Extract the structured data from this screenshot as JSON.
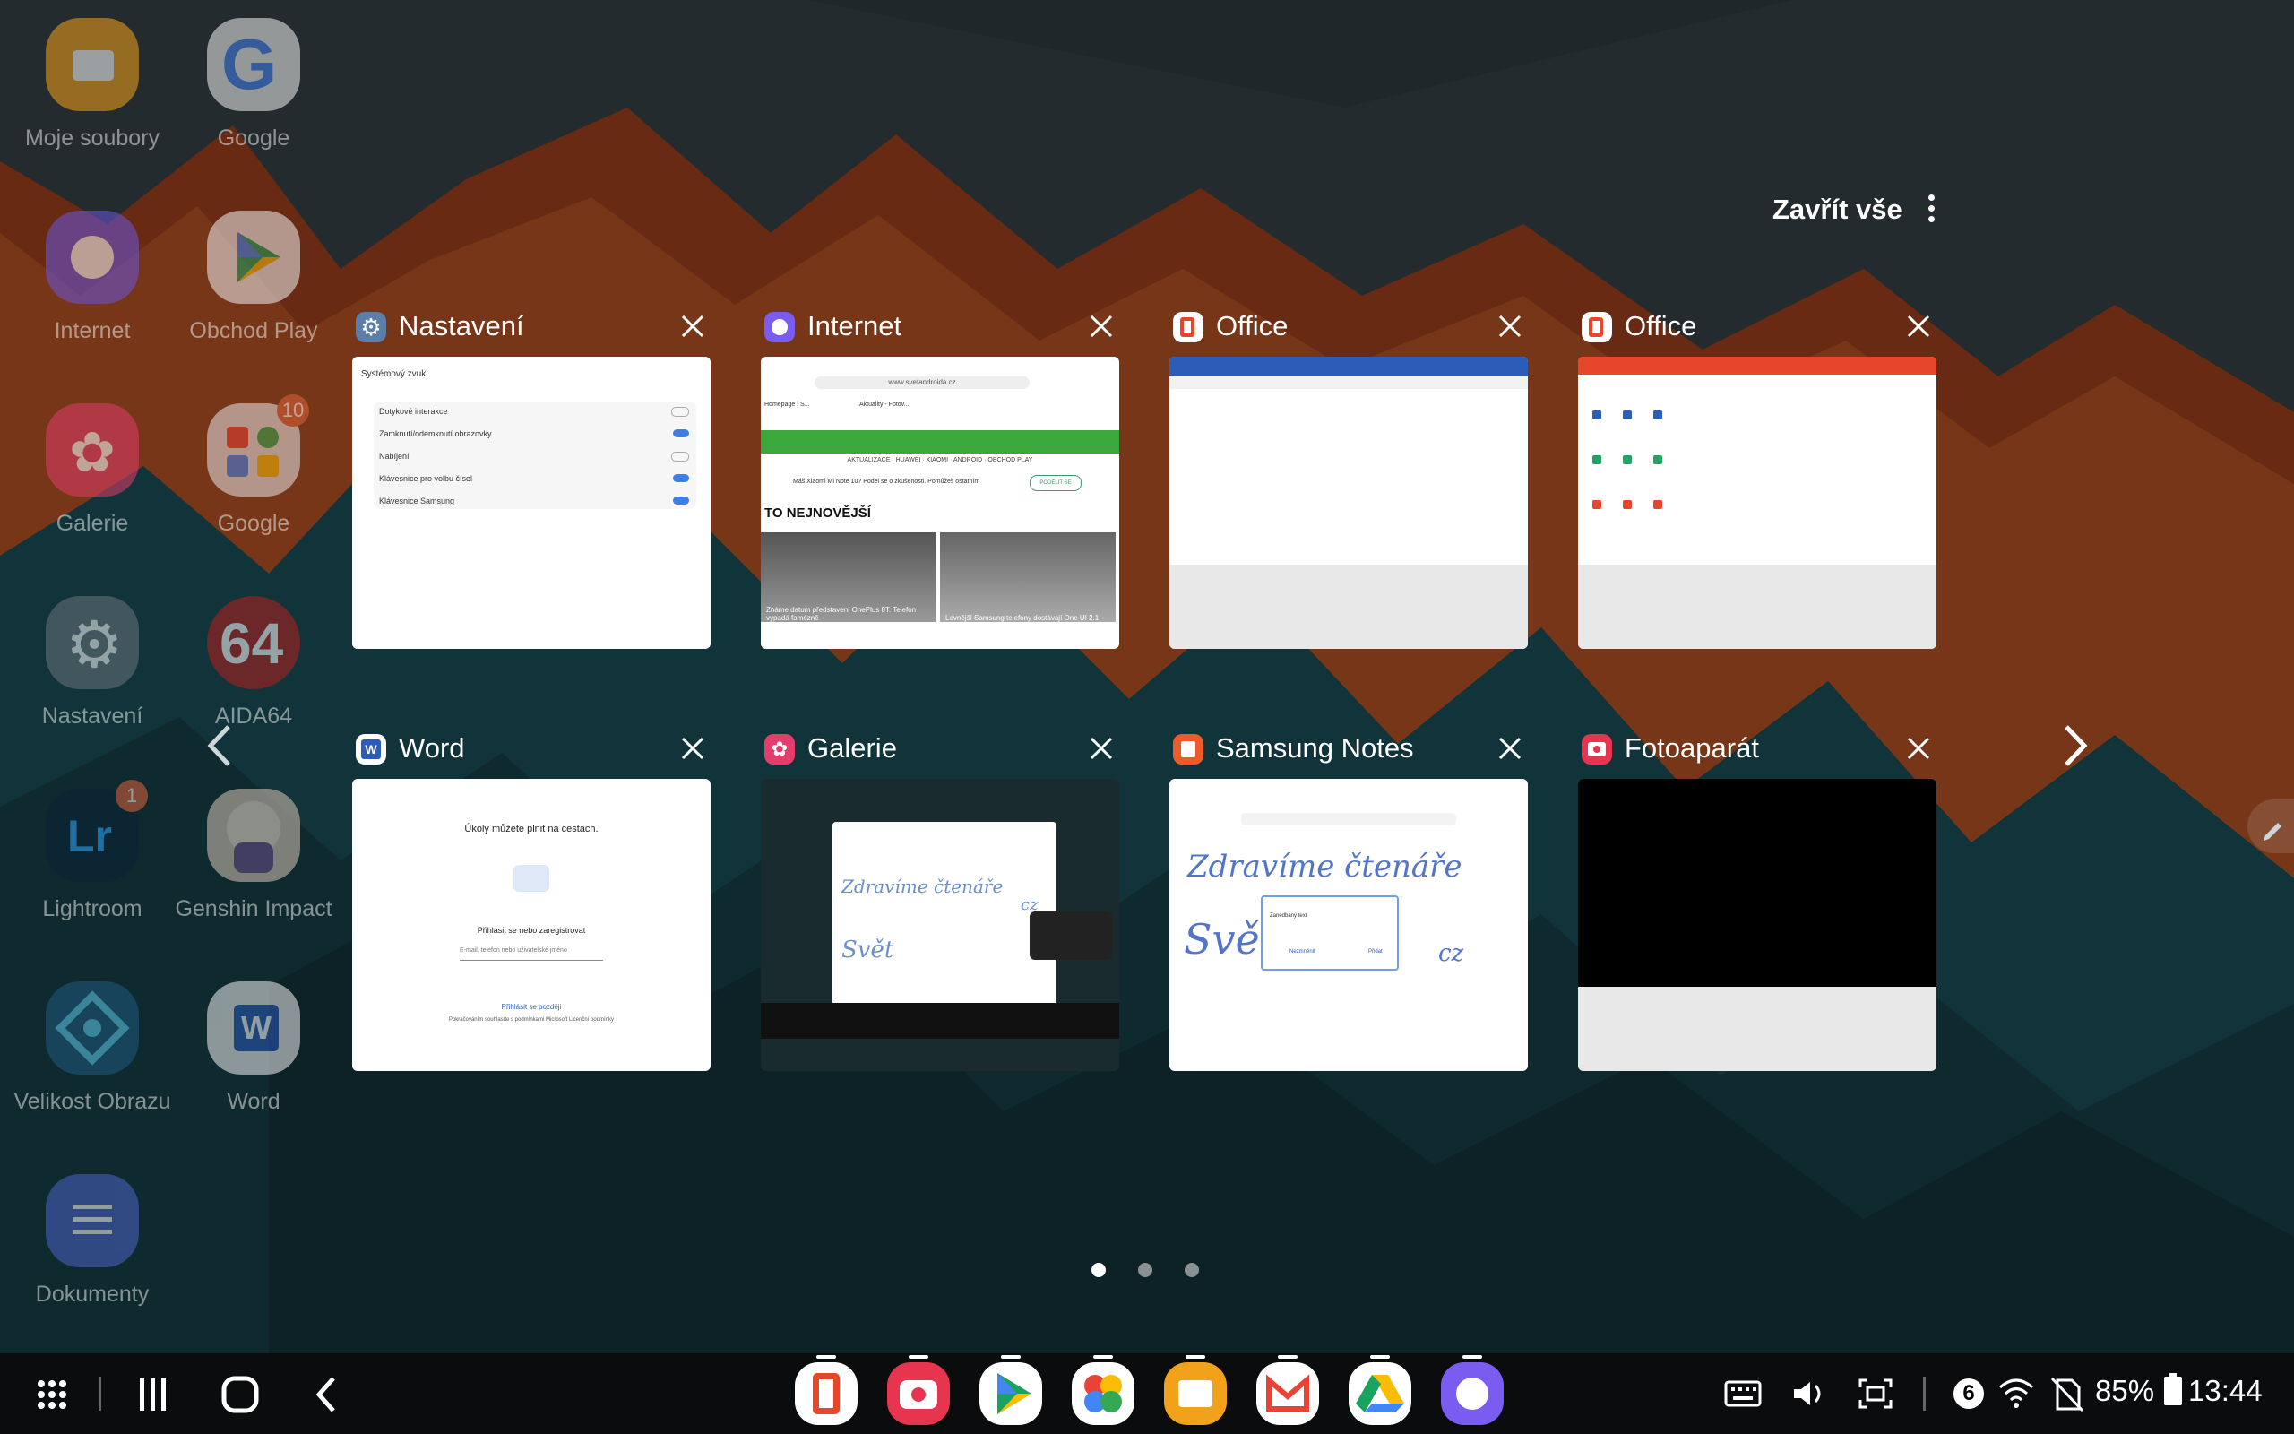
{
  "header": {
    "close_all": "Zavřít vše"
  },
  "home_apps": [
    {
      "label": "Moje soubory"
    },
    {
      "label": "Google"
    },
    {
      "label": "Internet"
    },
    {
      "label": "Obchod Play"
    },
    {
      "label": "Galerie"
    },
    {
      "label": "Google",
      "badge": "10"
    },
    {
      "label": "Nastavení"
    },
    {
      "label": "AIDA64"
    },
    {
      "label": "Lightroom",
      "badge": "1"
    },
    {
      "label": "Genshin Impact"
    },
    {
      "label": "Velikost Obrazu"
    },
    {
      "label": "Word"
    },
    {
      "label": "Dokumenty"
    }
  ],
  "recents": [
    {
      "app": "Nastavení",
      "icon": "settings-icon",
      "color": "#5b7fa8"
    },
    {
      "app": "Internet",
      "icon": "samsung-internet-icon",
      "color": "#7b5cf0"
    },
    {
      "app": "Office",
      "icon": "office-icon",
      "color": "#e6462a"
    },
    {
      "app": "Office",
      "icon": "office-icon",
      "color": "#e6462a"
    },
    {
      "app": "Word",
      "icon": "word-icon",
      "color": "#2b5cb8"
    },
    {
      "app": "Galerie",
      "icon": "gallery-icon",
      "color": "#e23d6b"
    },
    {
      "app": "Samsung Notes",
      "icon": "samsung-notes-icon",
      "color": "#ee5a2a"
    },
    {
      "app": "Fotoaparát",
      "icon": "camera-icon",
      "color": "#e7344f"
    }
  ],
  "thumbs": {
    "settings": {
      "header": "Systémový zvuk",
      "rows": [
        "Dotykové interakce",
        "Zamknutí/odemknutí obrazovky",
        "Nabíjení",
        "Klávesnice pro volbu čísel",
        "Klávesnice Samsung"
      ]
    },
    "internet": {
      "url": "www.svetandroida.cz",
      "tab1": "Homepage | S...",
      "tab2": "Aktuality - Fotov...",
      "menu": "AKTUALIZACE · HUAWEI · XIAOMI · ANDROID · OBCHOD PLAY",
      "promo": "Máš Xiaomi Mi Note 10? Podel se o zkušenosti. Pomůžeš ostatním",
      "promo_btn": "PODĚLIT SE",
      "section": "TO NEJNOVĚJŠÍ",
      "article1": "Známe datum představení OnePlus 8T. Telefon vypadá famózně",
      "article2": "Levnější Samsung telefony dostávají One UI 2.1"
    },
    "word": {
      "line1": "Úkoly můžete plnit na cestách.",
      "line2": "Přihlásit se nebo zaregistrovat",
      "input_hint": "E-mail, telefon nebo uživatelské jméno",
      "link": "Přihlásit se později",
      "footer": "Pokračováním souhlasíte s podmínkami Microsoft Licenční podmínky"
    },
    "notes": {
      "handwriting1": "Zdravíme čtenáře",
      "handwriting2": "Svět",
      "handwriting3": "cz",
      "dialog": "Zanedbaný text",
      "dialog_cancel": "Nezmněnit",
      "dialog_ok": "Přidat"
    },
    "gallery": {
      "handwriting1": "Zdravíme čtenáře",
      "handwriting2": "Svět",
      "handwriting3": "cz"
    }
  },
  "pagination": {
    "pages": 3,
    "current": 1
  },
  "status": {
    "notification_count": "6",
    "battery": "85%",
    "time": "13:44"
  },
  "colors": {
    "accent": "#e46a1e",
    "wallpaper_teal": "#0f4a52",
    "taskbar": "#0b0c0e"
  }
}
